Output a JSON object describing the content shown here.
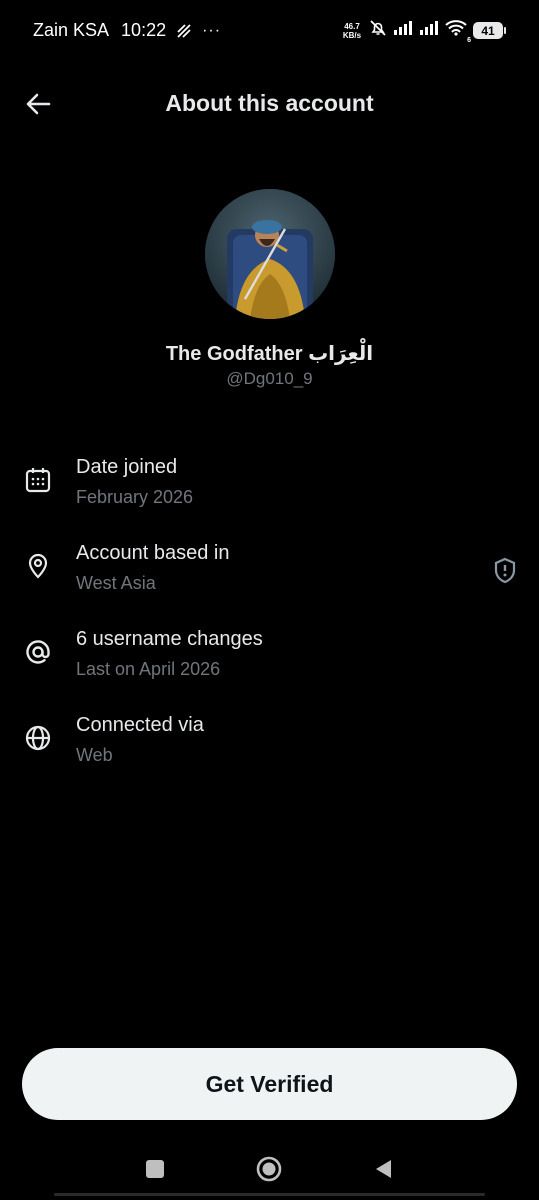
{
  "status_bar": {
    "carrier": "Zain KSA",
    "time": "10:22",
    "more": "···",
    "net_speed_value": "46.7",
    "net_speed_unit": "KB/s",
    "wifi_badge": "6",
    "battery": "41"
  },
  "header": {
    "title": "About this account",
    "back_icon": "arrow-left-icon"
  },
  "profile": {
    "display_name": "The Godfather الْعِرَاب",
    "handle": "@Dg010_9"
  },
  "info": [
    {
      "icon": "calendar-icon",
      "title": "Date joined",
      "subtitle": "February 2026"
    },
    {
      "icon": "location-pin-icon",
      "title": "Account based in",
      "subtitle": "West Asia",
      "action_icon": "shield-alert-icon"
    },
    {
      "icon": "at-sign-icon",
      "title": "6 username changes",
      "subtitle": "Last on April 2026"
    },
    {
      "icon": "globe-icon",
      "title": "Connected via",
      "subtitle": "Web"
    }
  ],
  "cta": {
    "label": "Get Verified"
  },
  "nav": {
    "recents_icon": "square-icon",
    "home_icon": "circle-icon",
    "back_icon": "triangle-back-icon"
  },
  "colors": {
    "background": "#000000",
    "primary_text": "#e7e9ea",
    "secondary_text": "#71767b",
    "button_bg": "#eff3f4"
  }
}
